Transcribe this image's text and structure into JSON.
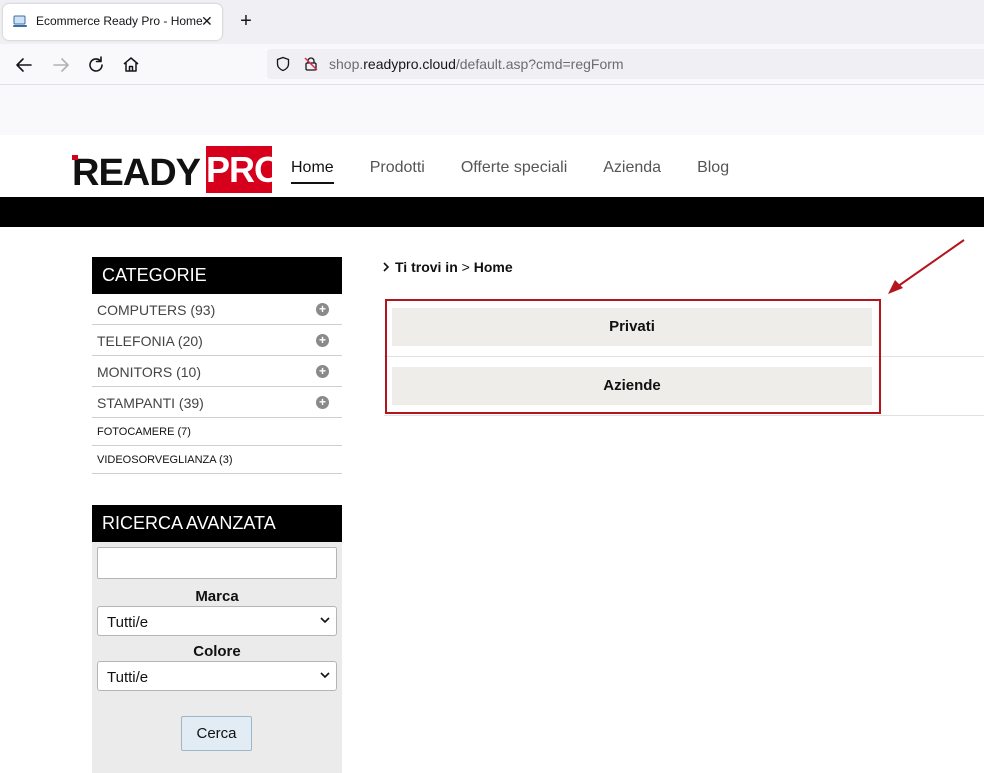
{
  "browser": {
    "tab_title": "Ecommerce Ready Pro - Home",
    "tab_close": "✕",
    "new_tab": "+",
    "url_domain_prefix": "shop.",
    "url_domain": "readypro.cloud",
    "url_path": "/default.asp?cmd=regForm"
  },
  "header": {
    "logo_ready": "READY",
    "logo_pro": "PRO",
    "nav": [
      "Home",
      "Prodotti",
      "Offerte speciali",
      "Azienda",
      "Blog"
    ],
    "active_nav": "Home"
  },
  "categories": {
    "title": "CATEGORIE",
    "items": [
      {
        "label": "COMPUTERS (93)",
        "expandable": true
      },
      {
        "label": "TELEFONIA (20)",
        "expandable": true
      },
      {
        "label": "MONITORS (10)",
        "expandable": true
      },
      {
        "label": "STAMPANTI (39)",
        "expandable": true
      },
      {
        "label": "FOTOCAMERE (7)",
        "expandable": false
      },
      {
        "label": "VIDEOSORVEGLIANZA (3)",
        "expandable": false
      }
    ],
    "plus_symbol": "+"
  },
  "advanced_search": {
    "title": "RICERCA AVANZATA",
    "query_value": "",
    "brand_label": "Marca",
    "brand_value": "Tutti/e",
    "color_label": "Colore",
    "color_value": "Tutti/e",
    "submit_label": "Cerca"
  },
  "main": {
    "breadcrumb_prefix": "Ti trovi in",
    "breadcrumb_sep": ">",
    "breadcrumb_current": "Home",
    "choices": [
      "Privati",
      "Aziende"
    ]
  },
  "colors": {
    "brand_red": "#d6001c",
    "annotation_red": "#b4141e",
    "header_black": "#000000"
  }
}
